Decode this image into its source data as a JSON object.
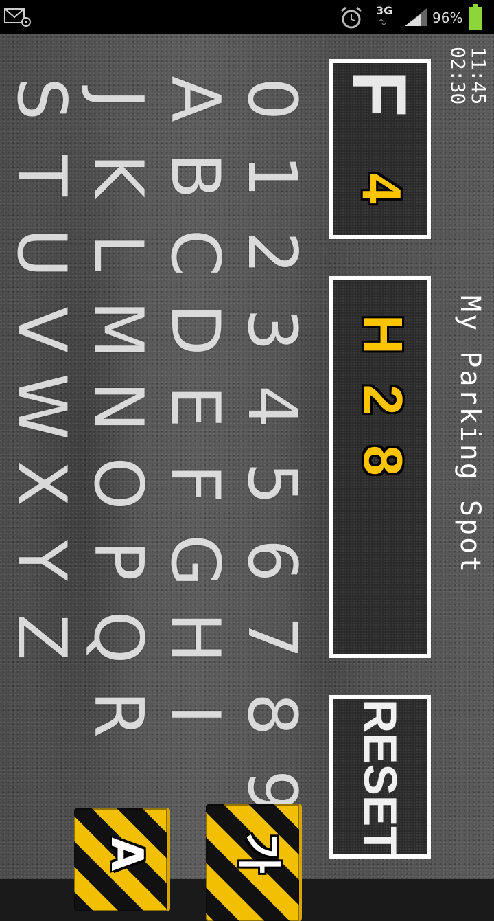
{
  "status_bar": {
    "mail_icon": "email-at-icon",
    "alarm_icon": "alarm-clock-icon",
    "network": "3G",
    "network_arrows": "⇅",
    "signal_icon": "signal-bars-icon",
    "battery_percent": "96%",
    "battery_icon": "battery-icon"
  },
  "header": {
    "clock_line1": "11:45",
    "clock_line2": "02:30",
    "title": "My Parking Spot"
  },
  "display": {
    "floor_letter": "F",
    "floor_number": "4",
    "spot_code": "H28",
    "reset_label": "RESET"
  },
  "keyboard": {
    "rows": [
      [
        "0",
        "1",
        "2",
        "3",
        "4",
        "5",
        "6",
        "7",
        "8",
        "9",
        "△"
      ],
      [
        "A",
        "B",
        "C",
        "D",
        "E",
        "F",
        "G",
        "H",
        "I"
      ],
      [
        "J",
        "K",
        "L",
        "M",
        "N",
        "O",
        "P",
        "Q",
        "R"
      ],
      [
        "S",
        "T",
        "U",
        "V",
        "W",
        "X",
        "Y",
        "Z"
      ]
    ]
  },
  "mode_buttons": {
    "korean_label": "가",
    "alpha_label": "A"
  },
  "colors": {
    "accent_yellow": "#ffc400",
    "panel_border": "#ffffff",
    "asphalt": "#555555"
  }
}
